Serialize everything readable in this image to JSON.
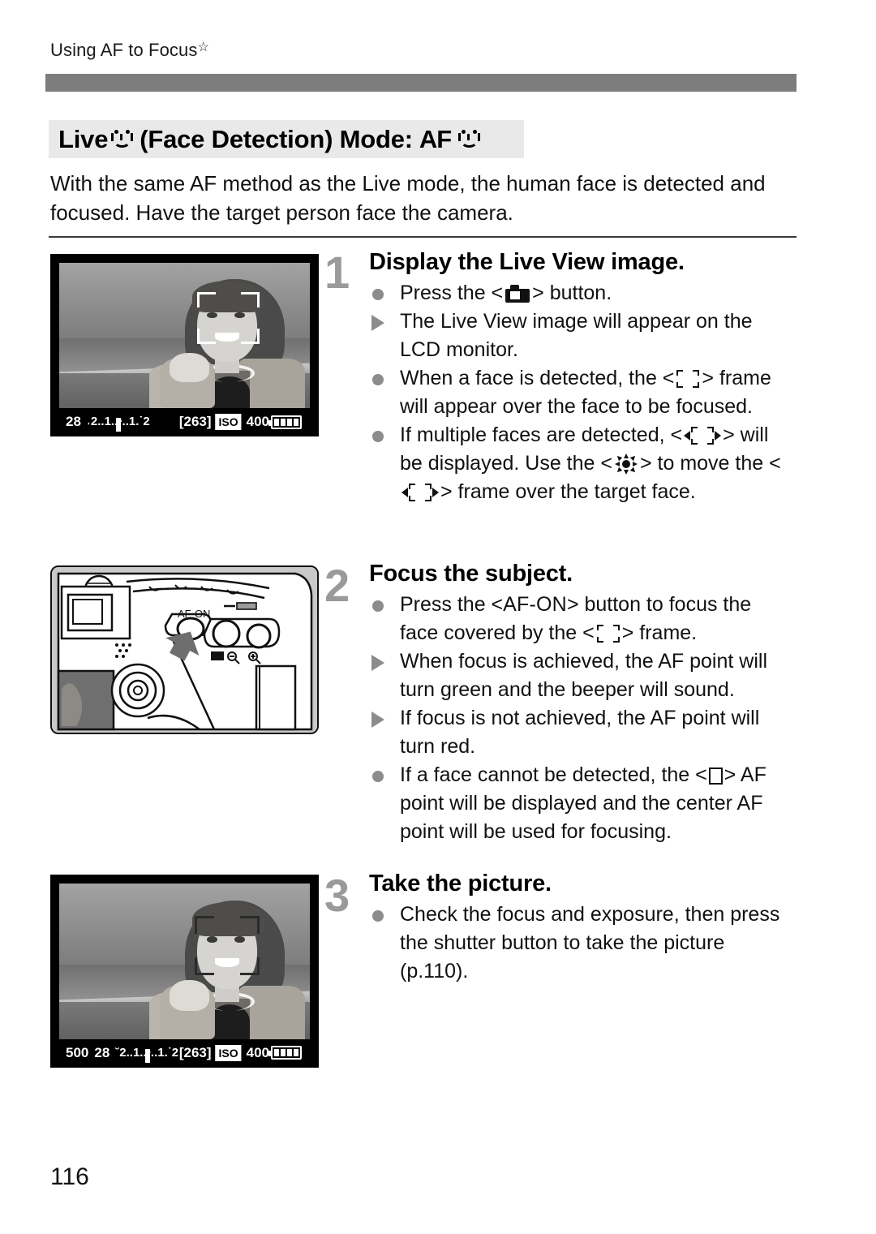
{
  "running_header": {
    "text": "Using AF to Focus",
    "star": "☆"
  },
  "section": {
    "title_prefix": "Live",
    "title_middle": "(Face Detection) Mode:",
    "title_af": "AF",
    "icon_face_mode": "smiley-face-detection-icon"
  },
  "intro": "With the same AF method as the Live mode, the human face is detected and focused. Have the target person face the camera.",
  "steps": [
    {
      "number": "1",
      "heading": "Display the Live View image.",
      "bullets": [
        {
          "mark": "dot",
          "parts": [
            "Press the <",
            "camera-button-icon",
            "> button."
          ]
        },
        {
          "mark": "tri",
          "parts": [
            "The Live View image will appear on the LCD monitor."
          ]
        },
        {
          "mark": "dot",
          "parts": [
            "When a face is detected, the <",
            "face-frame-icon",
            "> frame will appear over the face to be focused."
          ]
        },
        {
          "mark": "dot",
          "parts": [
            "If multiple faces are detected, <",
            "multi-face-frame-icon",
            "> will be displayed. Use the <",
            "multi-controller-icon",
            "> to move the <",
            "multi-face-frame-icon",
            "> frame over the target face."
          ]
        }
      ]
    },
    {
      "number": "2",
      "heading": "Focus the subject.",
      "bullets": [
        {
          "mark": "dot",
          "parts": [
            "Press the <",
            "AF-ON",
            "> button to focus the face covered by the <",
            "face-frame-icon",
            "> frame."
          ]
        },
        {
          "mark": "tri",
          "parts": [
            "When focus is achieved, the AF point will turn green and the beeper will sound."
          ]
        },
        {
          "mark": "tri",
          "parts": [
            "If focus is not achieved, the AF point will turn red."
          ]
        },
        {
          "mark": "dot",
          "parts": [
            "If a face cannot be detected, the <",
            "af-point-icon",
            "> AF point will be displayed and the center AF point will be used for focusing."
          ]
        }
      ]
    },
    {
      "number": "3",
      "heading": "Take the picture.",
      "bullets": [
        {
          "mark": "dot",
          "parts": [
            "Check the focus and exposure, then press the shutter button to take the picture (p.110)."
          ]
        }
      ]
    }
  ],
  "step1_text": {
    "b1_a": "Press the <",
    "b1_b": "> button.",
    "b2": "The Live View image will appear on the LCD monitor.",
    "b3_a": "When a face is detected, the <",
    "b3_b": "> frame will appear over the face to be focused.",
    "b4_a": "If multiple faces are detected, <",
    "b4_b": "> will be displayed. Use the <",
    "b4_c": "> to move the <",
    "b4_d": "> frame over the target face."
  },
  "step2_text": {
    "b1_a": "Press the <",
    "b1_key": "AF-ON",
    "b1_b": "> button to focus the face covered by the <",
    "b1_c": "> frame.",
    "b2": "When focus is achieved, the AF point will turn green and the beeper will sound.",
    "b3": "If focus is not achieved, the AF point will turn red.",
    "b4_a": "If a face cannot be detected, the <",
    "b4_b": "> AF point will be displayed and the center AF point will be used for focusing."
  },
  "step3_text": {
    "b1": "Check the focus and exposure, then press the shutter button to take the picture (p.110)."
  },
  "figures": {
    "lcd_top": {
      "name": "live-view-face-detected",
      "status": {
        "shutter": "",
        "aperture": "28",
        "meter_scale": "˒2..1..•..1.˙2",
        "shots_remaining": "[263]",
        "iso_label": "ISO",
        "iso_value": "400",
        "battery_bars": 4
      }
    },
    "camera_back": {
      "name": "camera-back-af-on-button",
      "button_label": "AF-ON",
      "zoom_out_icon": "magnifier-minus-icon",
      "zoom_in_icon": "magnifier-plus-icon"
    },
    "lcd_bottom": {
      "name": "live-view-focused-face",
      "status": {
        "shutter": "500",
        "aperture": "28",
        "meter_scale": "˘2..1..•..1.˙2",
        "shots_remaining": "[263]",
        "iso_label": "ISO",
        "iso_value": "400",
        "battery_bars": 4
      }
    }
  },
  "page_number": "116",
  "colors": {
    "header_bar": "#7d7d7d",
    "title_band": "#e9e9e9",
    "step_number": "#9a9a9a",
    "bullet_mark": "#8c8c8c",
    "rule": "#3a3a3a"
  }
}
